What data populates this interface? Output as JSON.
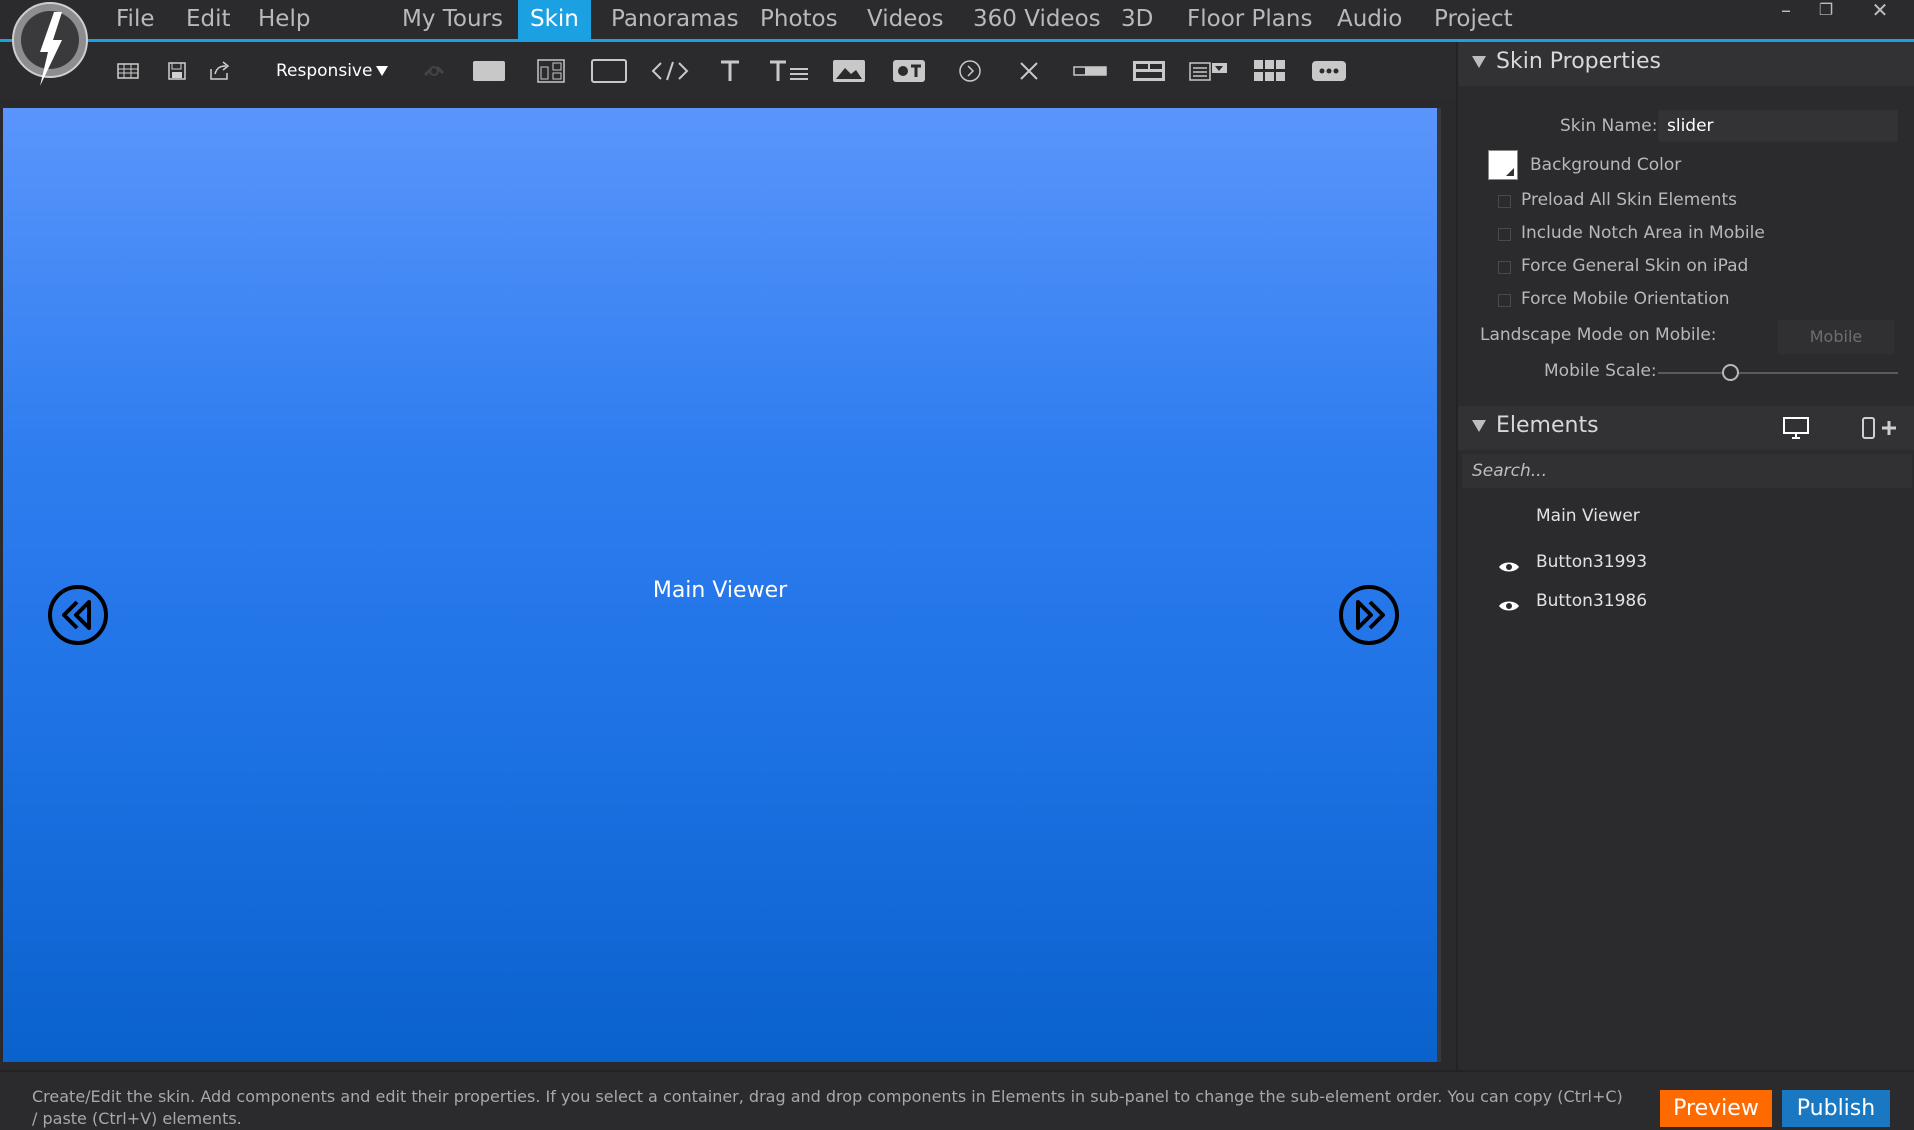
{
  "menu": {
    "file": "File",
    "edit": "Edit",
    "help": "Help"
  },
  "tabs": [
    {
      "label": "My Tours"
    },
    {
      "label": "Skin",
      "active": true
    },
    {
      "label": "Panoramas"
    },
    {
      "label": "Photos"
    },
    {
      "label": "Videos"
    },
    {
      "label": "360 Videos"
    },
    {
      "label": "3D"
    },
    {
      "label": "Floor Plans"
    },
    {
      "label": "Audio"
    },
    {
      "label": "Project"
    }
  ],
  "window_controls": {
    "minimize": "–",
    "restore": "❐",
    "close": "✕"
  },
  "toolbar": {
    "responsive_label": "Responsive",
    "responsive_arrow": "▼",
    "icons": [
      "grid-icon",
      "save-icon",
      "export-icon",
      "link-icon",
      "rectangle-icon",
      "layout-icon",
      "container-icon",
      "code-icon",
      "text-icon",
      "text-list-icon",
      "image-icon",
      "toggle-icon",
      "play-icon",
      "close-icon",
      "progress-bar-icon",
      "tabs-icon",
      "dropdown-icon",
      "thumbnail-grid-icon",
      "more-icon"
    ]
  },
  "canvas": {
    "main_viewer_label": "Main Viewer",
    "prev_button": "rewind-icon",
    "next_button": "fast-forward-icon"
  },
  "skin_properties": {
    "title": "Skin Properties",
    "skin_name_label": "Skin Name:",
    "skin_name_value": "slider",
    "background_color_label": "Background Color",
    "background_color": "#ffffff",
    "preload_label": "Preload All Skin Elements",
    "notch_label": "Include Notch Area in Mobile",
    "force_general_label": "Force General Skin on iPad",
    "force_mobile_label": "Force Mobile Orientation",
    "landscape_label": "Landscape Mode on Mobile:",
    "landscape_value": "Mobile",
    "mobile_scale_label": "Mobile Scale:",
    "mobile_scale_value": 0.3
  },
  "elements": {
    "title": "Elements",
    "search_placeholder": "Search...",
    "items": [
      {
        "label": "Main Viewer",
        "visible_toggle": false
      },
      {
        "label": "Button31993",
        "visible_toggle": true
      },
      {
        "label": "Button31986",
        "visible_toggle": true
      }
    ]
  },
  "status": {
    "text": "Create/Edit the skin. Add components and edit their properties. If you select a container, drag and drop components in Elements in sub-panel to change the sub-element order. You can copy (Ctrl+C) / paste (Ctrl+V) elements."
  },
  "actions": {
    "preview": "Preview",
    "publish": "Publish"
  },
  "colors": {
    "accent": "#1ba1e2",
    "preview": "#ff6a00",
    "publish": "#1a78c2",
    "viewer_top": "#5a95fc",
    "viewer_bottom": "#0a62cd"
  }
}
